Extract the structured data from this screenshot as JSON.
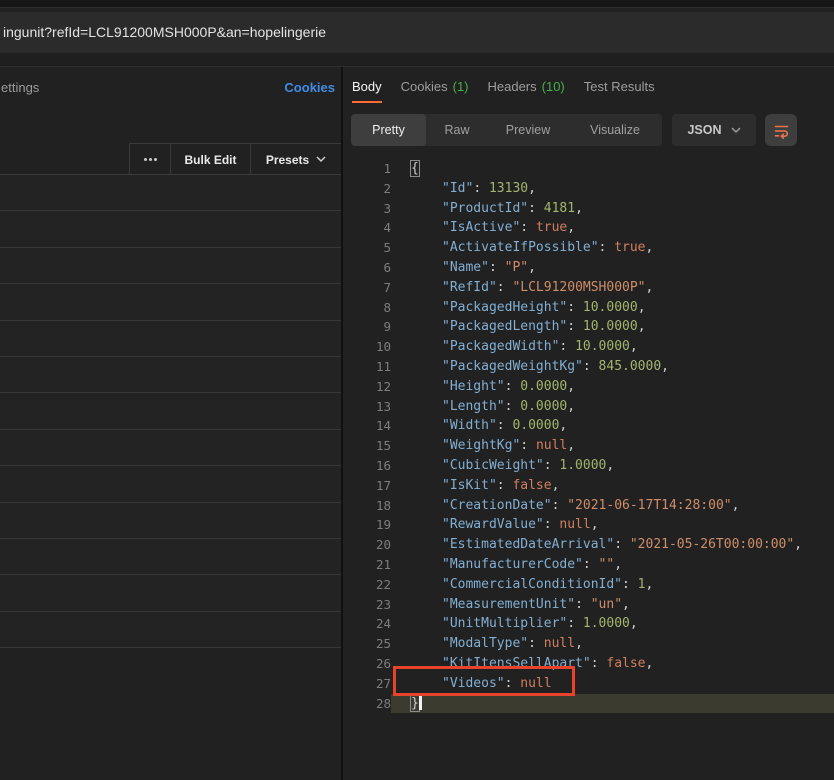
{
  "url_bar": {
    "text": "ingunit?refId=LCL91200MSH000P&an=hopelingerie"
  },
  "request_panel": {
    "settings_tab_label": "ettings",
    "cookies_link_label": "Cookies",
    "toolbar": {
      "more_icon": "more-options-icon",
      "bulk_edit_label": "Bulk Edit",
      "presets_label": "Presets"
    },
    "empty_row_count": 13
  },
  "response_panel": {
    "tabs": [
      {
        "label": "Body",
        "count": "",
        "active": true
      },
      {
        "label": "Cookies",
        "count": "(1)",
        "active": false
      },
      {
        "label": "Headers",
        "count": "(10)",
        "active": false
      },
      {
        "label": "Test Results",
        "count": "",
        "active": false
      }
    ],
    "view_modes": [
      "Pretty",
      "Raw",
      "Preview",
      "Visualize"
    ],
    "active_view_mode": "Pretty",
    "format_dropdown_value": "JSON",
    "wrap_button_icon": "wrap-lines-icon"
  },
  "colors": {
    "accent_orange": "#ff6c37",
    "count_green": "#47b04b",
    "link_blue": "#3f8de4",
    "annotation_red": "#e8432a",
    "key_blue": "#82afd3",
    "string_orange": "#ce8e68",
    "number_green": "#a3b56e",
    "keyword_salmon": "#d07f5f"
  },
  "code": {
    "language": "json",
    "annotation": "red box around line 27",
    "lines": [
      {
        "n": 1,
        "ind": false,
        "t": [
          [
            "p",
            "{",
            "box"
          ]
        ]
      },
      {
        "n": 2,
        "ind": true,
        "t": [
          [
            "k",
            "\"Id\""
          ],
          [
            "p",
            ": "
          ],
          [
            "n",
            "13130"
          ],
          [
            "p",
            ","
          ]
        ]
      },
      {
        "n": 3,
        "ind": true,
        "t": [
          [
            "k",
            "\"ProductId\""
          ],
          [
            "p",
            ": "
          ],
          [
            "n",
            "4181"
          ],
          [
            "p",
            ","
          ]
        ]
      },
      {
        "n": 4,
        "ind": true,
        "t": [
          [
            "k",
            "\"IsActive\""
          ],
          [
            "p",
            ": "
          ],
          [
            "b",
            "true"
          ],
          [
            "p",
            ","
          ]
        ]
      },
      {
        "n": 5,
        "ind": true,
        "t": [
          [
            "k",
            "\"ActivateIfPossible\""
          ],
          [
            "p",
            ": "
          ],
          [
            "b",
            "true"
          ],
          [
            "p",
            ","
          ]
        ]
      },
      {
        "n": 6,
        "ind": true,
        "t": [
          [
            "k",
            "\"Name\""
          ],
          [
            "p",
            ": "
          ],
          [
            "s",
            "\"P\""
          ],
          [
            "p",
            ","
          ]
        ]
      },
      {
        "n": 7,
        "ind": true,
        "t": [
          [
            "k",
            "\"RefId\""
          ],
          [
            "p",
            ": "
          ],
          [
            "s",
            "\"LCL91200MSH000P\""
          ],
          [
            "p",
            ","
          ]
        ]
      },
      {
        "n": 8,
        "ind": true,
        "t": [
          [
            "k",
            "\"PackagedHeight\""
          ],
          [
            "p",
            ": "
          ],
          [
            "n",
            "10.0000"
          ],
          [
            "p",
            ","
          ]
        ]
      },
      {
        "n": 9,
        "ind": true,
        "t": [
          [
            "k",
            "\"PackagedLength\""
          ],
          [
            "p",
            ": "
          ],
          [
            "n",
            "10.0000"
          ],
          [
            "p",
            ","
          ]
        ]
      },
      {
        "n": 10,
        "ind": true,
        "t": [
          [
            "k",
            "\"PackagedWidth\""
          ],
          [
            "p",
            ": "
          ],
          [
            "n",
            "10.0000"
          ],
          [
            "p",
            ","
          ]
        ]
      },
      {
        "n": 11,
        "ind": true,
        "t": [
          [
            "k",
            "\"PackagedWeightKg\""
          ],
          [
            "p",
            ": "
          ],
          [
            "n",
            "845.0000"
          ],
          [
            "p",
            ","
          ]
        ]
      },
      {
        "n": 12,
        "ind": true,
        "t": [
          [
            "k",
            "\"Height\""
          ],
          [
            "p",
            ": "
          ],
          [
            "n",
            "0.0000"
          ],
          [
            "p",
            ","
          ]
        ]
      },
      {
        "n": 13,
        "ind": true,
        "t": [
          [
            "k",
            "\"Length\""
          ],
          [
            "p",
            ": "
          ],
          [
            "n",
            "0.0000"
          ],
          [
            "p",
            ","
          ]
        ]
      },
      {
        "n": 14,
        "ind": true,
        "t": [
          [
            "k",
            "\"Width\""
          ],
          [
            "p",
            ": "
          ],
          [
            "n",
            "0.0000"
          ],
          [
            "p",
            ","
          ]
        ]
      },
      {
        "n": 15,
        "ind": true,
        "t": [
          [
            "k",
            "\"WeightKg\""
          ],
          [
            "p",
            ": "
          ],
          [
            "b",
            "null"
          ],
          [
            "p",
            ","
          ]
        ]
      },
      {
        "n": 16,
        "ind": true,
        "t": [
          [
            "k",
            "\"CubicWeight\""
          ],
          [
            "p",
            ": "
          ],
          [
            "n",
            "1.0000"
          ],
          [
            "p",
            ","
          ]
        ]
      },
      {
        "n": 17,
        "ind": true,
        "t": [
          [
            "k",
            "\"IsKit\""
          ],
          [
            "p",
            ": "
          ],
          [
            "b",
            "false"
          ],
          [
            "p",
            ","
          ]
        ]
      },
      {
        "n": 18,
        "ind": true,
        "t": [
          [
            "k",
            "\"CreationDate\""
          ],
          [
            "p",
            ": "
          ],
          [
            "s",
            "\"2021-06-17T14:28:00\""
          ],
          [
            "p",
            ","
          ]
        ]
      },
      {
        "n": 19,
        "ind": true,
        "t": [
          [
            "k",
            "\"RewardValue\""
          ],
          [
            "p",
            ": "
          ],
          [
            "b",
            "null"
          ],
          [
            "p",
            ","
          ]
        ]
      },
      {
        "n": 20,
        "ind": true,
        "t": [
          [
            "k",
            "\"EstimatedDateArrival\""
          ],
          [
            "p",
            ": "
          ],
          [
            "s",
            "\"2021-05-26T00:00:00\""
          ],
          [
            "p",
            ","
          ]
        ]
      },
      {
        "n": 21,
        "ind": true,
        "t": [
          [
            "k",
            "\"ManufacturerCode\""
          ],
          [
            "p",
            ": "
          ],
          [
            "s",
            "\"\""
          ],
          [
            "p",
            ","
          ]
        ]
      },
      {
        "n": 22,
        "ind": true,
        "t": [
          [
            "k",
            "\"CommercialConditionId\""
          ],
          [
            "p",
            ": "
          ],
          [
            "n",
            "1"
          ],
          [
            "p",
            ","
          ]
        ]
      },
      {
        "n": 23,
        "ind": true,
        "t": [
          [
            "k",
            "\"MeasurementUnit\""
          ],
          [
            "p",
            ": "
          ],
          [
            "s",
            "\"un\""
          ],
          [
            "p",
            ","
          ]
        ]
      },
      {
        "n": 24,
        "ind": true,
        "t": [
          [
            "k",
            "\"UnitMultiplier\""
          ],
          [
            "p",
            ": "
          ],
          [
            "n",
            "1.0000"
          ],
          [
            "p",
            ","
          ]
        ]
      },
      {
        "n": 25,
        "ind": true,
        "t": [
          [
            "k",
            "\"ModalType\""
          ],
          [
            "p",
            ": "
          ],
          [
            "b",
            "null"
          ],
          [
            "p",
            ","
          ]
        ]
      },
      {
        "n": 26,
        "ind": true,
        "t": [
          [
            "k",
            "\"KitItensSellApart\""
          ],
          [
            "p",
            ": "
          ],
          [
            "b",
            "false"
          ],
          [
            "p",
            ","
          ]
        ]
      },
      {
        "n": 27,
        "ind": true,
        "t": [
          [
            "k",
            "\"Videos\""
          ],
          [
            "p",
            ": "
          ],
          [
            "b",
            "null"
          ]
        ]
      },
      {
        "n": 28,
        "ind": false,
        "t": [
          [
            "p",
            "}",
            "box"
          ]
        ],
        "hl": true,
        "cursor": true
      }
    ]
  }
}
